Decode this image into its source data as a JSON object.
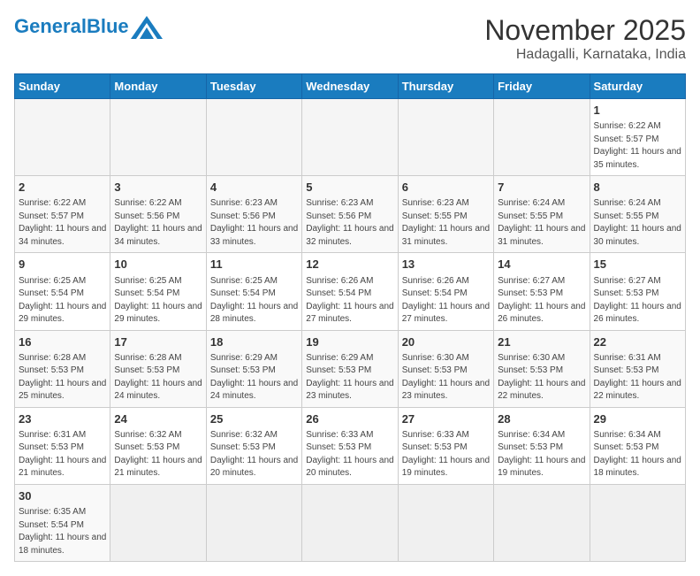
{
  "header": {
    "logo_text_regular": "General",
    "logo_text_blue": "Blue",
    "month_title": "November 2025",
    "location": "Hadagalli, Karnataka, India"
  },
  "weekdays": [
    "Sunday",
    "Monday",
    "Tuesday",
    "Wednesday",
    "Thursday",
    "Friday",
    "Saturday"
  ],
  "weeks": [
    [
      {
        "day": "",
        "info": ""
      },
      {
        "day": "",
        "info": ""
      },
      {
        "day": "",
        "info": ""
      },
      {
        "day": "",
        "info": ""
      },
      {
        "day": "",
        "info": ""
      },
      {
        "day": "",
        "info": ""
      },
      {
        "day": "1",
        "info": "Sunrise: 6:22 AM\nSunset: 5:57 PM\nDaylight: 11 hours and 35 minutes."
      }
    ],
    [
      {
        "day": "2",
        "info": "Sunrise: 6:22 AM\nSunset: 5:57 PM\nDaylight: 11 hours and 34 minutes."
      },
      {
        "day": "3",
        "info": "Sunrise: 6:22 AM\nSunset: 5:56 PM\nDaylight: 11 hours and 34 minutes."
      },
      {
        "day": "4",
        "info": "Sunrise: 6:23 AM\nSunset: 5:56 PM\nDaylight: 11 hours and 33 minutes."
      },
      {
        "day": "5",
        "info": "Sunrise: 6:23 AM\nSunset: 5:56 PM\nDaylight: 11 hours and 32 minutes."
      },
      {
        "day": "6",
        "info": "Sunrise: 6:23 AM\nSunset: 5:55 PM\nDaylight: 11 hours and 31 minutes."
      },
      {
        "day": "7",
        "info": "Sunrise: 6:24 AM\nSunset: 5:55 PM\nDaylight: 11 hours and 31 minutes."
      },
      {
        "day": "8",
        "info": "Sunrise: 6:24 AM\nSunset: 5:55 PM\nDaylight: 11 hours and 30 minutes."
      }
    ],
    [
      {
        "day": "9",
        "info": "Sunrise: 6:25 AM\nSunset: 5:54 PM\nDaylight: 11 hours and 29 minutes."
      },
      {
        "day": "10",
        "info": "Sunrise: 6:25 AM\nSunset: 5:54 PM\nDaylight: 11 hours and 29 minutes."
      },
      {
        "day": "11",
        "info": "Sunrise: 6:25 AM\nSunset: 5:54 PM\nDaylight: 11 hours and 28 minutes."
      },
      {
        "day": "12",
        "info": "Sunrise: 6:26 AM\nSunset: 5:54 PM\nDaylight: 11 hours and 27 minutes."
      },
      {
        "day": "13",
        "info": "Sunrise: 6:26 AM\nSunset: 5:54 PM\nDaylight: 11 hours and 27 minutes."
      },
      {
        "day": "14",
        "info": "Sunrise: 6:27 AM\nSunset: 5:53 PM\nDaylight: 11 hours and 26 minutes."
      },
      {
        "day": "15",
        "info": "Sunrise: 6:27 AM\nSunset: 5:53 PM\nDaylight: 11 hours and 26 minutes."
      }
    ],
    [
      {
        "day": "16",
        "info": "Sunrise: 6:28 AM\nSunset: 5:53 PM\nDaylight: 11 hours and 25 minutes."
      },
      {
        "day": "17",
        "info": "Sunrise: 6:28 AM\nSunset: 5:53 PM\nDaylight: 11 hours and 24 minutes."
      },
      {
        "day": "18",
        "info": "Sunrise: 6:29 AM\nSunset: 5:53 PM\nDaylight: 11 hours and 24 minutes."
      },
      {
        "day": "19",
        "info": "Sunrise: 6:29 AM\nSunset: 5:53 PM\nDaylight: 11 hours and 23 minutes."
      },
      {
        "day": "20",
        "info": "Sunrise: 6:30 AM\nSunset: 5:53 PM\nDaylight: 11 hours and 23 minutes."
      },
      {
        "day": "21",
        "info": "Sunrise: 6:30 AM\nSunset: 5:53 PM\nDaylight: 11 hours and 22 minutes."
      },
      {
        "day": "22",
        "info": "Sunrise: 6:31 AM\nSunset: 5:53 PM\nDaylight: 11 hours and 22 minutes."
      }
    ],
    [
      {
        "day": "23",
        "info": "Sunrise: 6:31 AM\nSunset: 5:53 PM\nDaylight: 11 hours and 21 minutes."
      },
      {
        "day": "24",
        "info": "Sunrise: 6:32 AM\nSunset: 5:53 PM\nDaylight: 11 hours and 21 minutes."
      },
      {
        "day": "25",
        "info": "Sunrise: 6:32 AM\nSunset: 5:53 PM\nDaylight: 11 hours and 20 minutes."
      },
      {
        "day": "26",
        "info": "Sunrise: 6:33 AM\nSunset: 5:53 PM\nDaylight: 11 hours and 20 minutes."
      },
      {
        "day": "27",
        "info": "Sunrise: 6:33 AM\nSunset: 5:53 PM\nDaylight: 11 hours and 19 minutes."
      },
      {
        "day": "28",
        "info": "Sunrise: 6:34 AM\nSunset: 5:53 PM\nDaylight: 11 hours and 19 minutes."
      },
      {
        "day": "29",
        "info": "Sunrise: 6:34 AM\nSunset: 5:53 PM\nDaylight: 11 hours and 18 minutes."
      }
    ],
    [
      {
        "day": "30",
        "info": "Sunrise: 6:35 AM\nSunset: 5:54 PM\nDaylight: 11 hours and 18 minutes."
      },
      {
        "day": "",
        "info": ""
      },
      {
        "day": "",
        "info": ""
      },
      {
        "day": "",
        "info": ""
      },
      {
        "day": "",
        "info": ""
      },
      {
        "day": "",
        "info": ""
      },
      {
        "day": "",
        "info": ""
      }
    ]
  ]
}
